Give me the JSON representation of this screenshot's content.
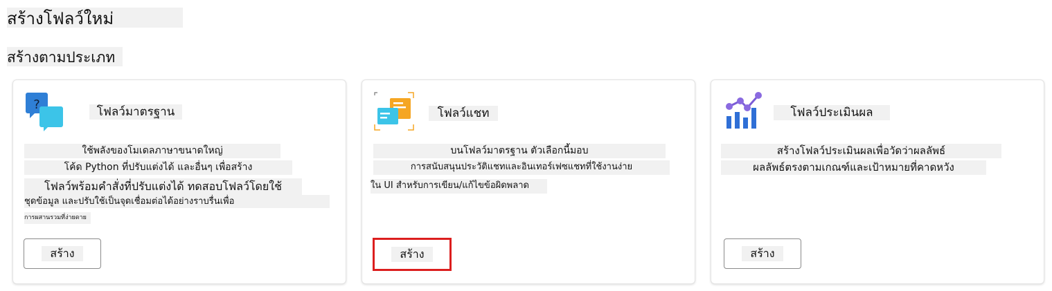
{
  "page": {
    "title": "สร้างโฟลว์ใหม่",
    "section_title": "สร้างตามประเภท"
  },
  "cards": [
    {
      "title": "โฟลว์มาตรฐาน",
      "icon": "chat-question-icon",
      "description": [
        "ใช้พลังของโมเดลภาษาขนาดใหญ่",
        "โค้ด Python ที่ปรับแต่งได้ และอื่นๆ เพื่อสร้าง",
        "โฟลว์พร้อมคำสั่งที่ปรับแต่งได้ ทดสอบโฟลว์โดยใช้",
        "ชุดข้อมูล และปรับใช้เป็นจุดเชื่อมต่อได้อย่างราบรื่นเพื่อ",
        "การผสานรวมที่ง่ายดาย"
      ],
      "button_label": "สร้าง"
    },
    {
      "title": "โฟลว์แชท",
      "icon": "chat-bubbles-icon",
      "description": [
        "บนโฟลว์มาตรฐาน ตัวเลือกนี้มอบ",
        "การสนับสนุนประวัติแชทและอินเทอร์เฟซแชทที่ใช้งานง่าย",
        "ใน UI สำหรับการเขียน/แก้ไขข้อผิดพลาด"
      ],
      "button_label": "สร้าง"
    },
    {
      "title": "โฟลว์ประเมินผล",
      "icon": "evaluation-chart-icon",
      "description": [
        "สร้างโฟลว์ประเมินผลเพื่อวัดว่าผลลัพธ์",
        "ผลลัพธ์ตรงตามเกณฑ์และเป้าหมายที่คาดหวัง"
      ],
      "button_label": "สร้าง"
    }
  ],
  "colors": {
    "focus_outline": "#dc1e1e",
    "chat_blue": "#2f7fd6",
    "chat_cyan": "#3cc4e8",
    "chat_orange": "#f5a623",
    "eval_purple": "#7b5cd6",
    "eval_blue": "#2f6fd6"
  }
}
